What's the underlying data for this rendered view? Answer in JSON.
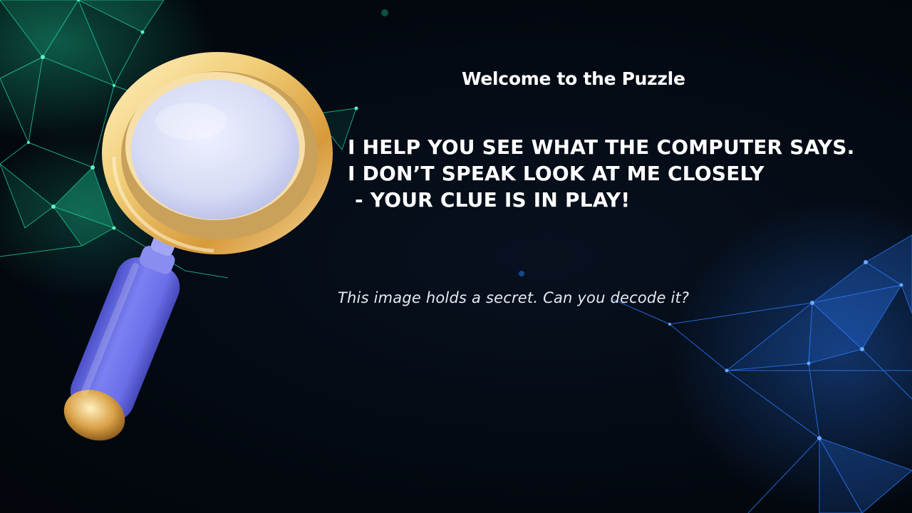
{
  "title": "Welcome to the Puzzle",
  "riddle": {
    "line1": "I HELP YOU SEE WHAT THE COMPUTER SAYS.",
    "line2": "I DON’T SPEAK LOOK AT ME CLOSELY",
    "line3": " - YOUR CLUE IS IN PLAY!"
  },
  "caption": "This image holds a secret. Can you decode it?",
  "icons": {
    "magnifier": "magnifying-glass-icon"
  },
  "colors": {
    "background": "#040b14",
    "network_green": "#1fd6a0",
    "network_blue": "#2a7cff",
    "magnifier_rim": "#f2cf7a",
    "magnifier_lens": "#d7dcf5",
    "magnifier_handle": "#6b6fe8",
    "text": "#ffffff"
  }
}
